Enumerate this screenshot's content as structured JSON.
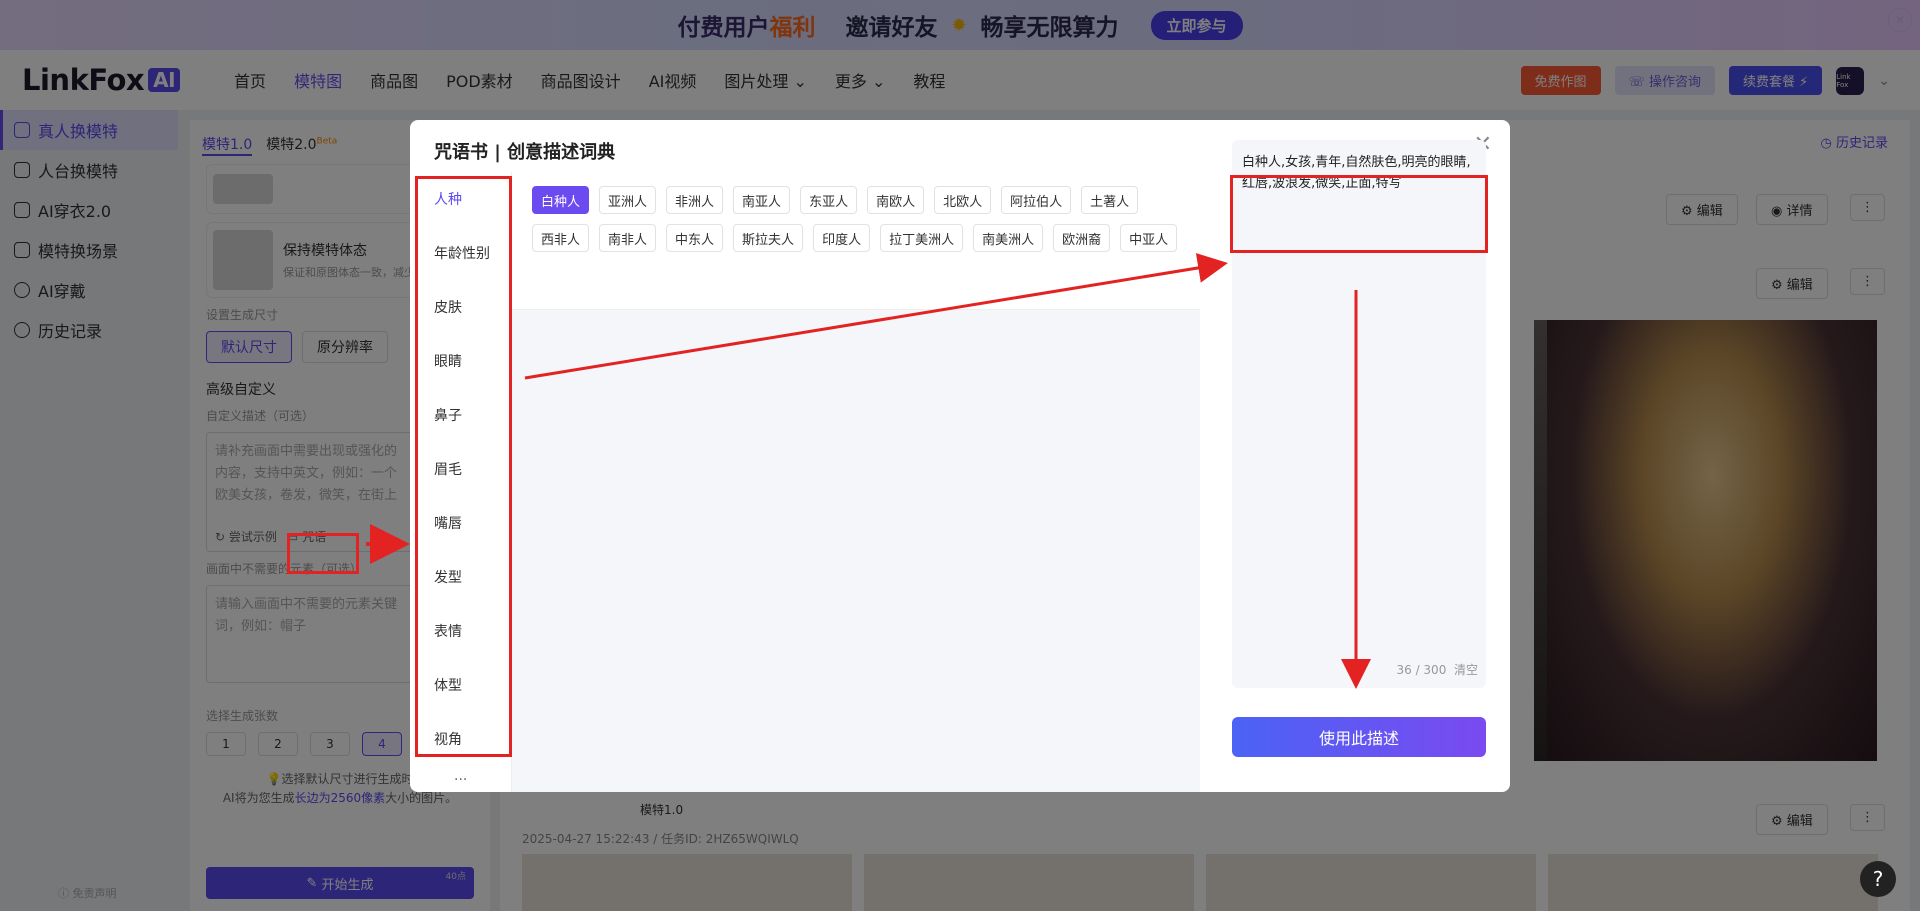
{
  "banner": {
    "part1": "付费用户",
    "part1_highlight": "福利",
    "part2": "邀请好友",
    "part3": "畅享无限算力",
    "join_btn": "立即参与"
  },
  "logo": {
    "text": "LinkFox",
    "badge": "AI"
  },
  "nav": {
    "items": [
      "首页",
      "模特图",
      "商品图",
      "POD素材",
      "商品图设计",
      "AI视频",
      "图片处理",
      "更多",
      "教程"
    ],
    "active": "模特图"
  },
  "navright": {
    "free_btn": "免费作图",
    "consult_btn": "操作咨询",
    "renew_btn": "续费套餐",
    "avatar_text": "Link Fox"
  },
  "sidebar": {
    "items": [
      "真人换模特",
      "人台换模特",
      "AI穿衣2.0",
      "模特换场景",
      "AI穿戴",
      "历史记录"
    ],
    "active": "真人换模特",
    "disclaimer": "免责声明"
  },
  "config": {
    "tab1": "模特1.0",
    "tab2": "模特2.0",
    "tab2_badge": "Beta",
    "card_title": "保持模特体态",
    "card_desc": "保证和原图体态一致，减少变形",
    "size_label": "设置生成尺寸",
    "size_default": "默认尺寸",
    "size_orig": "原分辨率",
    "adv_label": "高级自定义",
    "desc_label": "自定义描述（可选）",
    "desc_placeholder": "请补充画面中需要出现或强化的内容，支持中英文，例如：一个欧美女孩，卷发，微笑，在街上",
    "try_example": "尝试示例",
    "spell_btn": "咒语",
    "neg_label": "画面中不需要的元素（可选）",
    "neg_placeholder": "请输入画面中不需要的元素关键词，例如：帽子",
    "count_label": "选择生成张数",
    "counts": [
      "1",
      "2",
      "3",
      "4"
    ],
    "count_active": "4",
    "tip_line1": "选择默认尺寸进行生成时",
    "tip_line2_pre": "AI将为您生成",
    "tip_line2_hl": "长边为2560像素",
    "tip_line2_post": "大小的图片。",
    "gen_btn": "开始生成",
    "gen_cost": "40点"
  },
  "results": {
    "history": "历史记录",
    "edit": "编辑",
    "detail": "详情",
    "model_label": "模特1.0",
    "meta": "2025-04-27 15:22:43 / 任务ID: 2HZ65WQIWLQ"
  },
  "modal": {
    "title": "咒语书 | 创意描述词典",
    "categories": [
      "人种",
      "年龄性别",
      "皮肤",
      "眼睛",
      "鼻子",
      "眉毛",
      "嘴唇",
      "发型",
      "表情",
      "体型",
      "视角"
    ],
    "active_category": "人种",
    "more": "...",
    "tags_row1": [
      "白种人",
      "亚洲人",
      "非洲人",
      "南亚人",
      "东亚人",
      "南欧人",
      "北欧人",
      "阿拉伯人",
      "土著人",
      "西非人",
      "南非人",
      "中东人",
      "斯拉夫人",
      "印度人",
      "拉丁美洲人",
      "南美洲人",
      "欧洲裔"
    ],
    "tags_row2": [
      "中亚人"
    ],
    "active_tag": "白种人",
    "description": "白种人,女孩,青年,自然肤色,明亮的眼睛,红唇,波浪发,微笑,正面,特写",
    "count": "36 / 300",
    "clear": "清空",
    "use_btn": "使用此描述"
  },
  "help": "?"
}
